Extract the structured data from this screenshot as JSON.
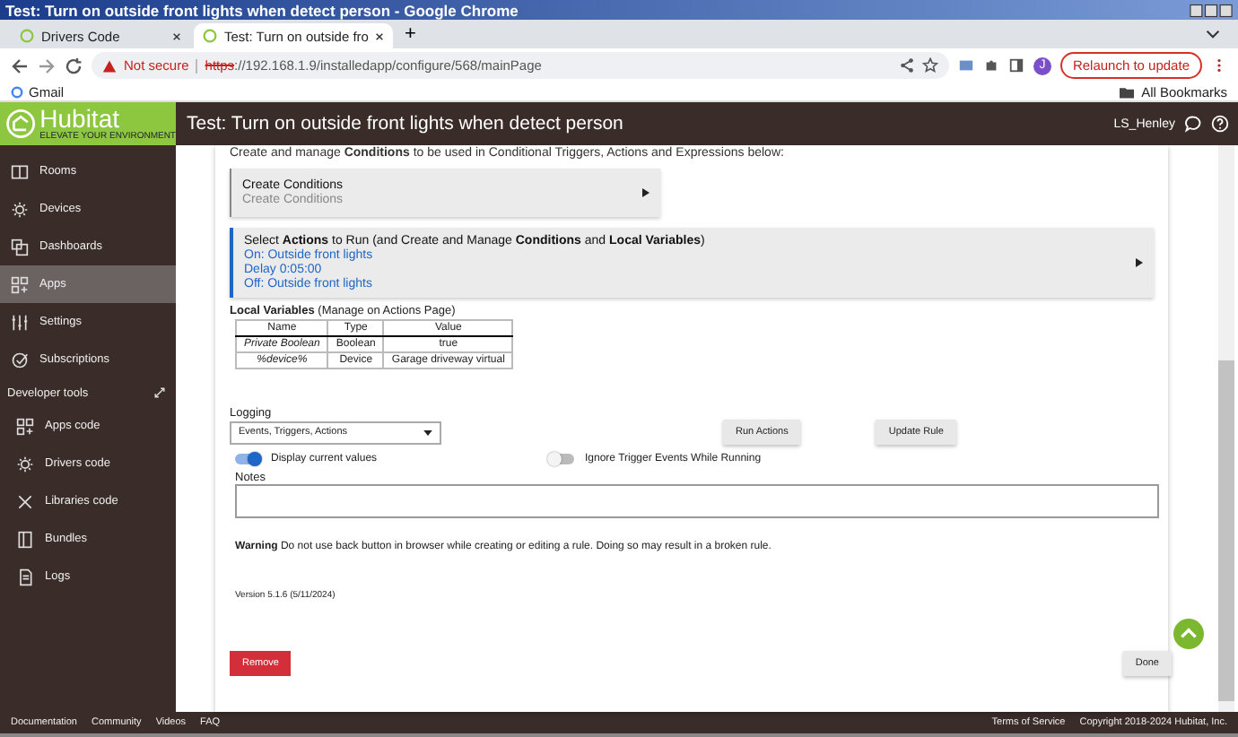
{
  "window": {
    "title": "Test: Turn on outside front lights when detect person - Google Chrome"
  },
  "tabs": [
    {
      "label": "Drivers Code",
      "selected": false
    },
    {
      "label": "Test: Turn on outside fro",
      "selected": true
    }
  ],
  "new_tab": "+",
  "address": {
    "warning": "Not secure",
    "url_scheme": "https",
    "url_rest": "://192.168.1.9/installedapp/configure/568/mainPage"
  },
  "relaunch": "Relaunch to update",
  "profile": "J",
  "bookmarks": [
    {
      "label": "Gmail"
    }
  ],
  "all_bookmarks": "All Bookmarks",
  "app": {
    "logo": "Hubitat",
    "tagline": "ELEVATE YOUR ENVIRONMENT",
    "page_title": "Test: Turn on outside front lights when detect person",
    "user": "LS_Henley"
  },
  "sidebar": {
    "items": [
      {
        "label": "Rooms",
        "selected": false
      },
      {
        "label": "Devices",
        "selected": false
      },
      {
        "label": "Dashboards",
        "selected": false
      },
      {
        "label": "Apps",
        "selected": true
      },
      {
        "label": "Settings",
        "selected": false
      },
      {
        "label": "Subscriptions",
        "selected": false
      }
    ],
    "section": "Developer tools",
    "dev_items": [
      {
        "label": "Apps code",
        "selected": false
      },
      {
        "label": "Drivers code",
        "selected": false
      },
      {
        "label": "Libraries code",
        "selected": false
      },
      {
        "label": "Bundles",
        "selected": false
      },
      {
        "label": "Logs",
        "selected": false
      }
    ]
  },
  "intro": "Create and manage **Conditions** to be used in Conditional Triggers, Actions and Expressions below:",
  "sections": [
    {
      "kind": "plain",
      "title": "Create Conditions",
      "lines": [
        "Create Conditions"
      ]
    },
    {
      "kind": "accent",
      "title": "Select **Actions** to Run (and Create and Manage **Conditions** and **Local Variables**)",
      "lines": [
        "On: Outside front lights",
        "Delay 0:05:00",
        "Off: Outside front lights"
      ]
    }
  ],
  "local_variables": {
    "title": "**Local Variables** (Manage on Actions Page)",
    "columns": [
      "Name",
      "Type",
      "Value"
    ],
    "rows": [
      [
        "Private Boolean",
        "Boolean",
        "true"
      ],
      [
        "%device%",
        "Device",
        "Garage driveway virtual"
      ]
    ]
  },
  "logging": {
    "label": "Logging",
    "value": "Events, Triggers, Actions"
  },
  "buttons": [
    "Run Actions",
    "Update Rule"
  ],
  "toggles": [
    {
      "label": "Display current values",
      "on": true
    },
    {
      "label": "Ignore Trigger Events While Running",
      "on": false
    }
  ],
  "notes": {
    "label": "Notes"
  },
  "warning": "**Warning** Do not use back button in browser while creating or editing a rule. Doing so may result in a broken rule.",
  "version": "Version 5.1.6 (5/11/2024)",
  "remove": "Remove",
  "done": "Done",
  "footer": {
    "links": [
      "Documentation",
      "Community",
      "Videos",
      "FAQ"
    ],
    "terms": "Terms of Service",
    "copyright": "Copyright 2018-2024 Hubitat, Inc."
  }
}
